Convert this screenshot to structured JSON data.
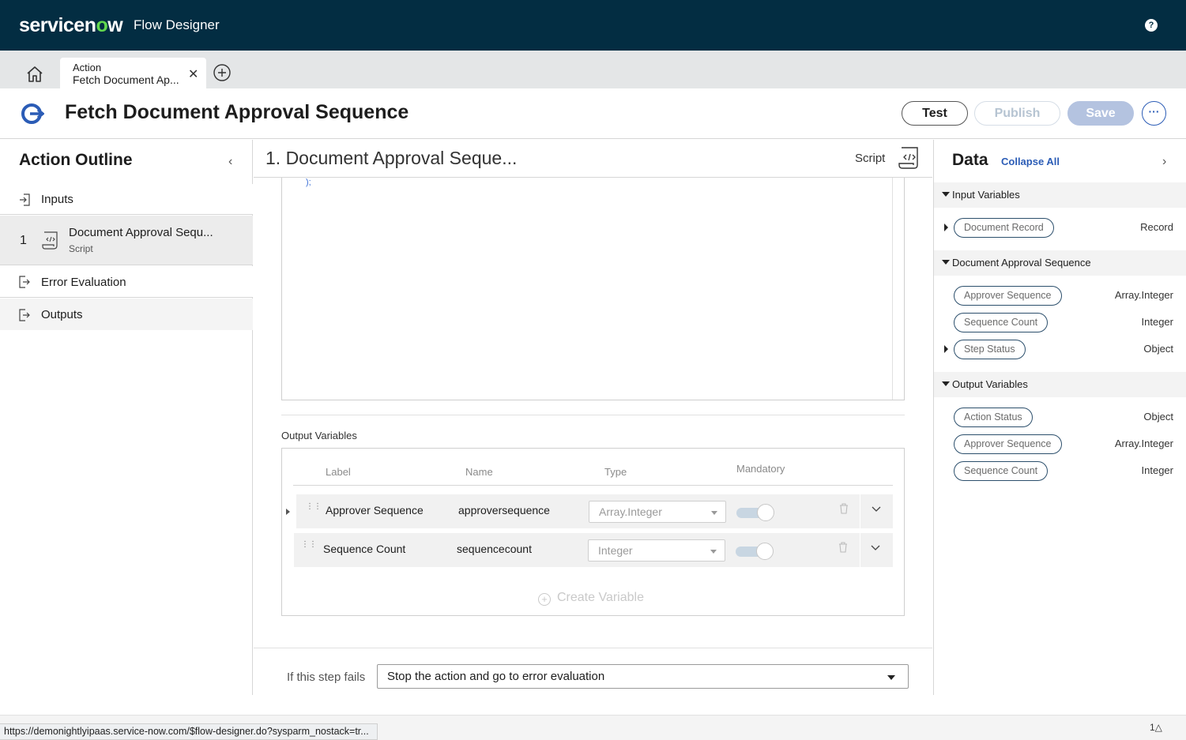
{
  "app": {
    "logo": "servicenow",
    "title": "Flow Designer",
    "help_icon": "?"
  },
  "tabs": [
    {
      "kind": "Action",
      "label": "Fetch Document Ap..."
    }
  ],
  "header": {
    "title": "Fetch Document Approval Sequence",
    "test_label": "Test",
    "publish_label": "Publish",
    "save_label": "Save",
    "more_label": "···"
  },
  "outline": {
    "title": "Action Outline",
    "inputs_label": "Inputs",
    "step": {
      "number": "1",
      "name": "Document Approval Sequ...",
      "type": "Script"
    },
    "error_label": "Error Evaluation",
    "outputs_label": "Outputs"
  },
  "step": {
    "title": "1.  Document Approval Seque...",
    "type_label": "Script",
    "editor_tail": ");"
  },
  "output_variables": {
    "title": "Output Variables",
    "columns": {
      "label": "Label",
      "name": "Name",
      "type": "Type",
      "mandatory": "Mandatory"
    },
    "rows": [
      {
        "label": "Approver Sequence",
        "name": "approversequence",
        "type": "Array.Integer",
        "mandatory": false
      },
      {
        "label": "Sequence Count",
        "name": "sequencecount",
        "type": "Integer",
        "mandatory": false
      }
    ],
    "create_label": "Create Variable"
  },
  "fail": {
    "label": "If this step fails",
    "value": "Stop the action and go to error evaluation"
  },
  "data_pane": {
    "title": "Data",
    "collapse_all": "Collapse All",
    "groups": [
      {
        "label": "Input Variables",
        "items": [
          {
            "label": "Document Record",
            "type": "Record"
          }
        ]
      },
      {
        "label": "Document Approval Sequence",
        "items": [
          {
            "label": "Approver Sequence",
            "type": "Array.Integer"
          },
          {
            "label": "Sequence Count",
            "type": "Integer"
          },
          {
            "label": "Step Status",
            "type": "Object"
          }
        ]
      },
      {
        "label": "Output Variables",
        "items": [
          {
            "label": "Action Status",
            "type": "Object"
          },
          {
            "label": "Approver Sequence",
            "type": "Array.Integer"
          },
          {
            "label": "Sequence Count",
            "type": "Integer"
          }
        ]
      }
    ]
  },
  "status_bar": {
    "url": "https://demonightlyipaas.service-now.com/$flow-designer.do?sysparm_nostack=tr...",
    "right_text": "1△"
  },
  "colors": {
    "topbar": "#032d42",
    "accent": "#2b5cb6",
    "logo_o": "#62d84e"
  }
}
